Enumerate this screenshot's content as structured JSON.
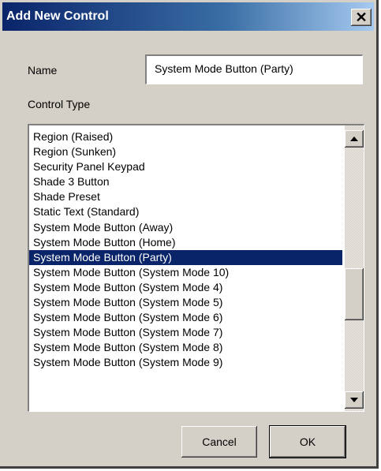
{
  "window": {
    "title": "Add New Control",
    "close_glyph": "✕"
  },
  "name_field": {
    "label": "Name",
    "value": "System Mode Button (Party)"
  },
  "control_type": {
    "label": "Control Type",
    "items": [
      "Region (Raised)",
      "Region (Sunken)",
      "Security Panel Keypad",
      "Shade 3 Button",
      "Shade Preset",
      "Static Text (Standard)",
      "System Mode Button (Away)",
      "System Mode Button (Home)",
      "System Mode Button (Party)",
      "System Mode Button (System Mode 10)",
      "System Mode Button (System Mode 4)",
      "System Mode Button (System Mode 5)",
      "System Mode Button (System Mode 6)",
      "System Mode Button (System Mode 7)",
      "System Mode Button (System Mode 8)",
      "System Mode Button (System Mode 9)"
    ],
    "selected_index": 8
  },
  "buttons": {
    "cancel": "Cancel",
    "ok": "OK"
  },
  "colors": {
    "selection": "#0a246a",
    "dialog_bg": "#d4d0c8",
    "title_start": "#0a246a",
    "title_end": "#a6caf0"
  },
  "icons": {
    "close": "close-icon",
    "scroll_up": "scroll-up-arrow-icon",
    "scroll_down": "scroll-down-arrow-icon"
  }
}
